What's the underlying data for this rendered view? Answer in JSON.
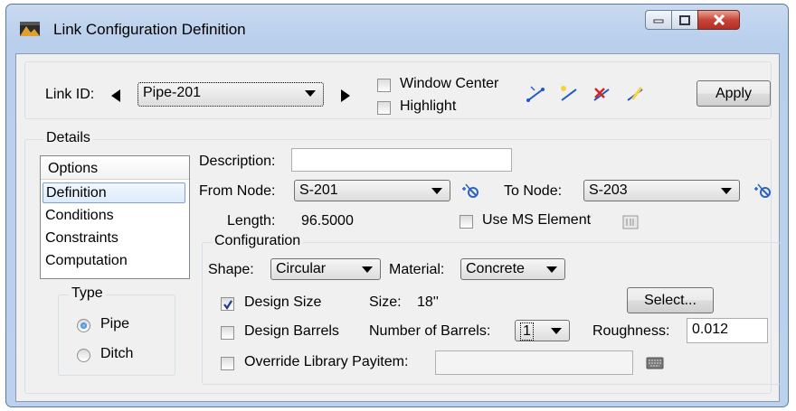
{
  "window": {
    "title": "Link Configuration Definition"
  },
  "header": {
    "link_id_label": "Link ID:",
    "link_id_value": "Pipe-201",
    "window_center_label": "Window Center",
    "window_center_checked": false,
    "highlight_label": "Highlight",
    "highlight_checked": false,
    "apply_label": "Apply"
  },
  "details": {
    "group_label": "Details",
    "options_header": "Options",
    "options": [
      "Definition",
      "Conditions",
      "Constraints",
      "Computation"
    ],
    "selected_option": "Definition",
    "type_label": "Type",
    "type_options": [
      "Pipe",
      "Ditch"
    ],
    "type_selected": "Pipe"
  },
  "definition": {
    "description_label": "Description:",
    "description_value": "",
    "from_node_label": "From Node:",
    "from_node_value": "S-201",
    "to_node_label": "To Node:",
    "to_node_value": "S-203",
    "length_label": "Length:",
    "length_value": "96.5000",
    "use_ms_element_label": "Use MS Element",
    "use_ms_element_checked": false
  },
  "configuration": {
    "group_label": "Configuration",
    "shape_label": "Shape:",
    "shape_value": "Circular",
    "material_label": "Material:",
    "material_value": "Concrete",
    "design_size_label": "Design Size",
    "design_size_checked": true,
    "size_label": "Size:",
    "size_value": "18''",
    "select_label": "Select...",
    "design_barrels_label": "Design Barrels",
    "design_barrels_checked": false,
    "barrels_label": "Number of Barrels:",
    "barrels_value": "1",
    "roughness_label": "Roughness:",
    "roughness_value": "0.012",
    "override_label": "Override Library Payitem:",
    "override_checked": false,
    "override_value": ""
  },
  "colors": {
    "accent": "#3399ff",
    "titlebar": "#c4d6ee",
    "close": "#c7463a"
  }
}
